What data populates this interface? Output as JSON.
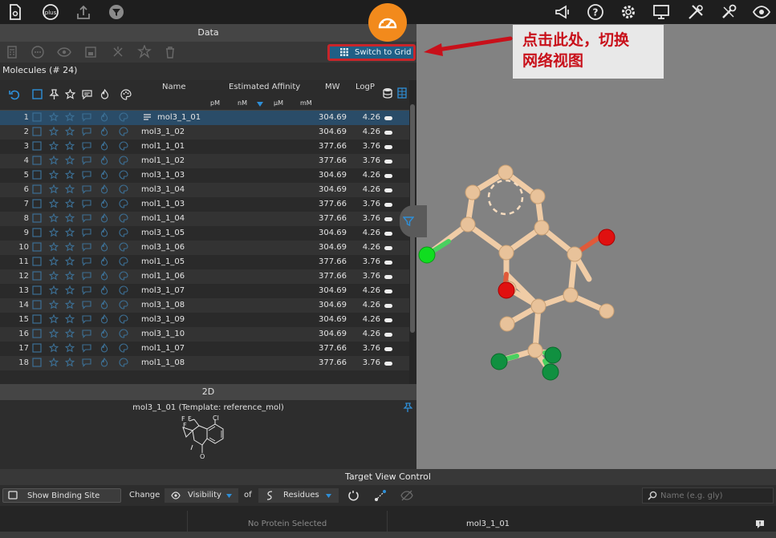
{
  "toolbar": {
    "left_icons": [
      "document-icon",
      "plus-icon",
      "upload-icon",
      "filter-icon"
    ],
    "right_icons": [
      "megaphone-icon",
      "help-icon",
      "gear-icon",
      "monitor-icon",
      "tools-icon",
      "wrench-icon",
      "eye-icon"
    ],
    "plus_label": "plus"
  },
  "data_panel": {
    "title": "Data",
    "switch_button": "Switch to Grid",
    "molecule_count": "Molecules (# 24)"
  },
  "table": {
    "headers": {
      "name": "Name",
      "affinity": "Estimated Affinity",
      "units": [
        "pM",
        "nM",
        "μM",
        "mM"
      ],
      "mw": "MW",
      "logp": "LogP"
    },
    "rows": [
      {
        "n": "1",
        "name": "mol3_1_01",
        "mw": "304.69",
        "logp": "4.26"
      },
      {
        "n": "2",
        "name": "mol3_1_02",
        "mw": "304.69",
        "logp": "4.26"
      },
      {
        "n": "3",
        "name": "mol1_1_01",
        "mw": "377.66",
        "logp": "3.76"
      },
      {
        "n": "4",
        "name": "mol1_1_02",
        "mw": "377.66",
        "logp": "3.76"
      },
      {
        "n": "5",
        "name": "mol3_1_03",
        "mw": "304.69",
        "logp": "4.26"
      },
      {
        "n": "6",
        "name": "mol3_1_04",
        "mw": "304.69",
        "logp": "4.26"
      },
      {
        "n": "7",
        "name": "mol1_1_03",
        "mw": "377.66",
        "logp": "3.76"
      },
      {
        "n": "8",
        "name": "mol1_1_04",
        "mw": "377.66",
        "logp": "3.76"
      },
      {
        "n": "9",
        "name": "mol3_1_05",
        "mw": "304.69",
        "logp": "4.26"
      },
      {
        "n": "10",
        "name": "mol3_1_06",
        "mw": "304.69",
        "logp": "4.26"
      },
      {
        "n": "11",
        "name": "mol1_1_05",
        "mw": "377.66",
        "logp": "3.76"
      },
      {
        "n": "12",
        "name": "mol1_1_06",
        "mw": "377.66",
        "logp": "3.76"
      },
      {
        "n": "13",
        "name": "mol3_1_07",
        "mw": "304.69",
        "logp": "4.26"
      },
      {
        "n": "14",
        "name": "mol3_1_08",
        "mw": "304.69",
        "logp": "4.26"
      },
      {
        "n": "15",
        "name": "mol3_1_09",
        "mw": "304.69",
        "logp": "4.26"
      },
      {
        "n": "16",
        "name": "mol3_1_10",
        "mw": "304.69",
        "logp": "4.26"
      },
      {
        "n": "17",
        "name": "mol1_1_07",
        "mw": "377.66",
        "logp": "3.76"
      },
      {
        "n": "18",
        "name": "mol1_1_08",
        "mw": "377.66",
        "logp": "3.76"
      }
    ]
  },
  "panel_2d": {
    "title": "2D",
    "caption": "mol3_1_01 (Template: reference_mol)",
    "atom_labels": {
      "cl": "Cl",
      "f1": "F",
      "f2": "F",
      "f3": "F",
      "o": "O"
    }
  },
  "callout": {
    "line1": "点击此处，切换",
    "line2": "网络视图"
  },
  "target_view": {
    "title": "Target View Control",
    "show_binding_site": "Show Binding Site Only",
    "change": "Change",
    "visibility": "Visibility",
    "of": "of",
    "residues": "Residues",
    "search_placeholder": "Name (e.g. gly)"
  },
  "status": {
    "protein": "No Protein Selected",
    "ligand": "mol3_1_01"
  },
  "colors": {
    "accent": "#1f5f86",
    "highlight": "#c8252a",
    "icon_blue": "#2e8fd8",
    "carbon": "#e8c29a",
    "oxygen": "#e01010",
    "chlorine": "#10dd20",
    "fluorine": "#109040"
  }
}
